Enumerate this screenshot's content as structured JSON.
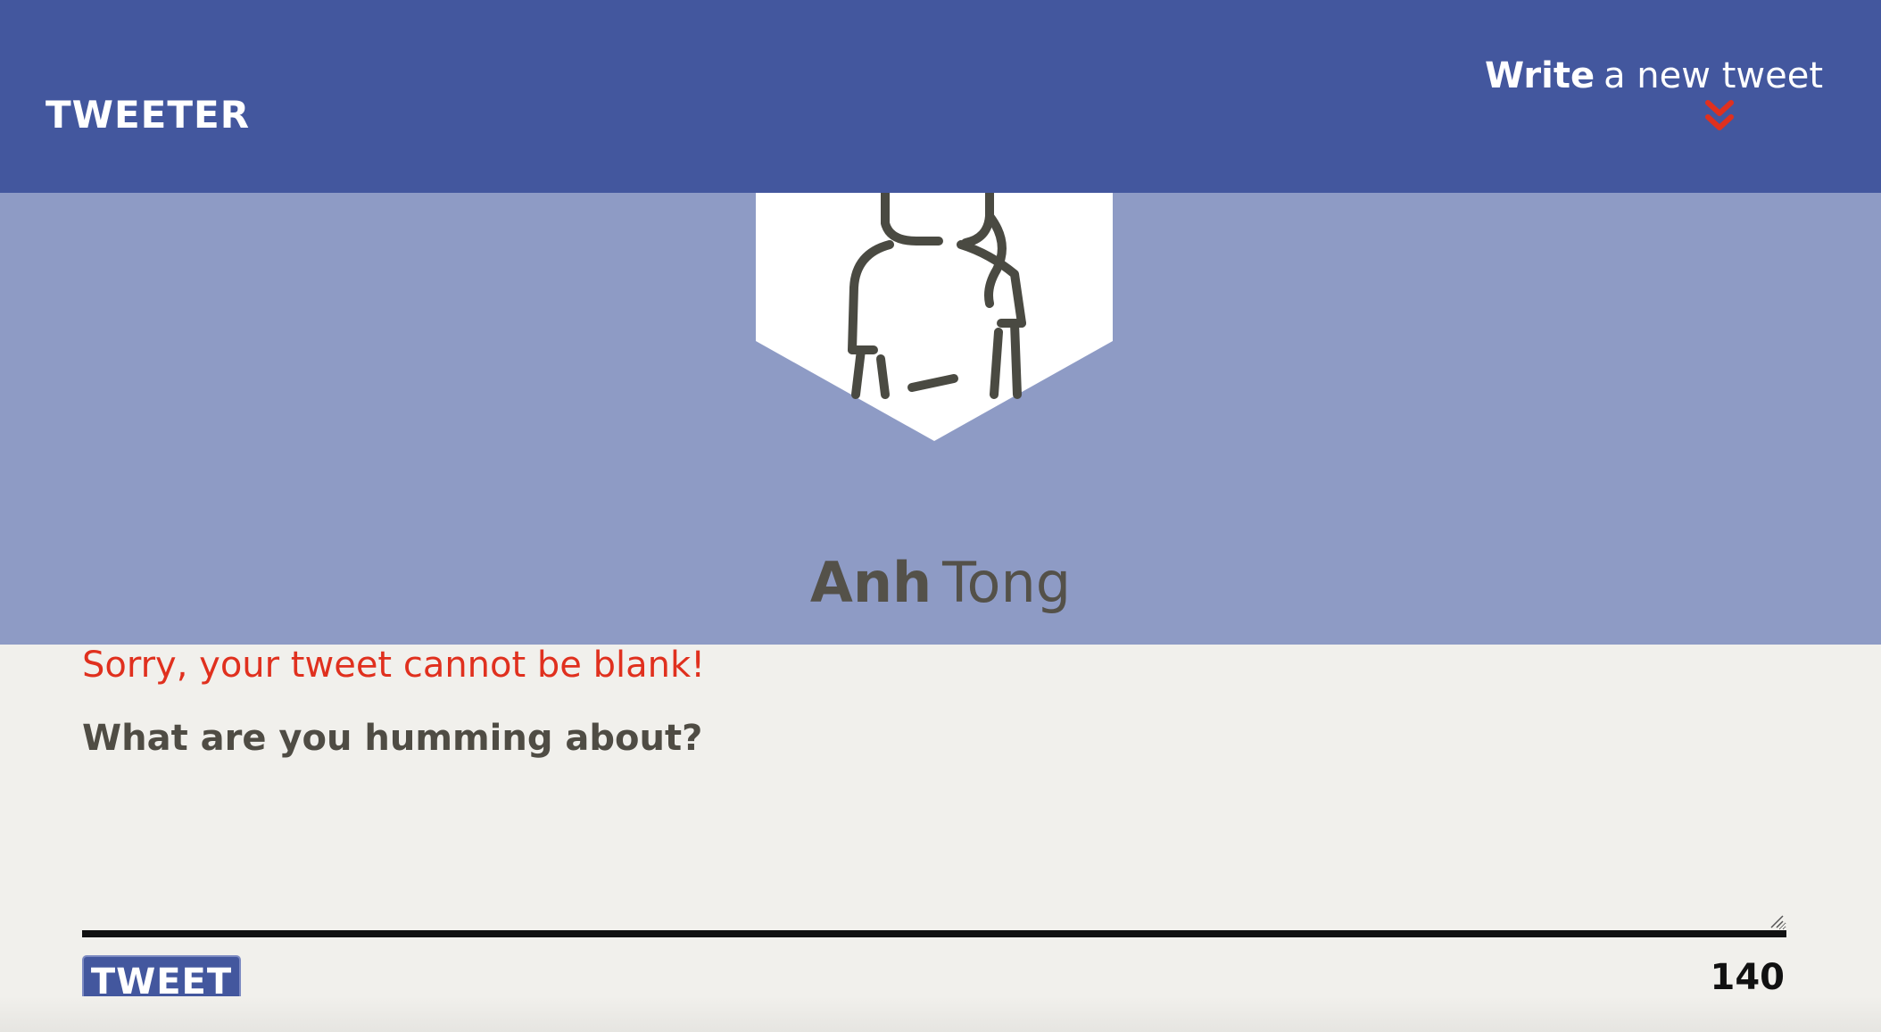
{
  "nav": {
    "brand": "TWEETER",
    "compose_bold": "Write",
    "compose_rest": "a new tweet",
    "compose_icon": "double-chevron-down-icon"
  },
  "profile": {
    "avatar_icon": "person-avatar-icon",
    "first_name": "Anh",
    "last_name": "Tong"
  },
  "compose": {
    "error": "Sorry, your tweet cannot be blank!",
    "prompt": "What are you humming about?",
    "text_value": "",
    "button_label": "TWEET",
    "counter": "140"
  },
  "colors": {
    "nav_bg": "#43579e",
    "profile_bg": "#8e9bc5",
    "page_bg": "#f1f0ec",
    "error": "#e0301e",
    "chevron": "#e0301e"
  }
}
